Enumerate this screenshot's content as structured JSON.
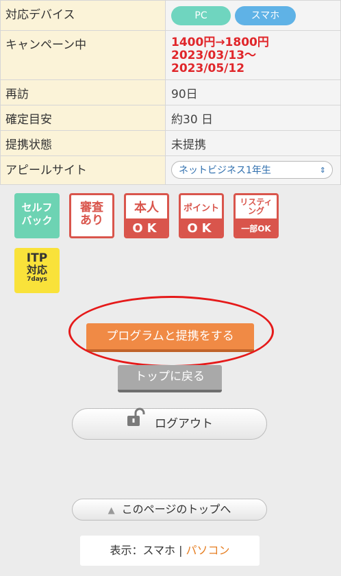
{
  "table": {
    "device_label": "対応デバイス",
    "device_pc": "PC",
    "device_sp": "スマホ",
    "campaign_label": "キャンペーン中",
    "campaign_line1": "1400円→1800円",
    "campaign_line2": "2023/03/13〜",
    "campaign_line3": "2023/05/12",
    "revisit_label": "再訪",
    "revisit_value": "90日",
    "confirm_label": "確定目安",
    "confirm_value": "約30 日",
    "status_label": "提携状態",
    "status_value": "未提携",
    "appeal_label": "アピールサイト",
    "appeal_selected": "ネットビジネス1年生"
  },
  "badges": {
    "self_line1": "セルフ",
    "self_line2": "バック",
    "shinsa_line1": "審査",
    "shinsa_line2": "あり",
    "honnin_top": "本人",
    "honnin_bot": "OK",
    "point_top": "ポイント",
    "point_bot": "OK",
    "listing_top1": "リスティ",
    "listing_top2": "ング",
    "listing_bot": "一部OK",
    "itp_line1": "ITP",
    "itp_line2": "対応",
    "itp_line3": "7days"
  },
  "buttons": {
    "program": "プログラムと提携をする",
    "back_top": "トップに戻る",
    "logout": "ログアウト",
    "page_top": "このページのトップへ"
  },
  "display": {
    "prefix": "表示：スマホ",
    "separator": "|",
    "pc_link": "パソコン"
  },
  "colors": {
    "accent_orange": "#f08a45",
    "highlight_red": "#e51a1a",
    "campaign_red": "#e0262a"
  }
}
